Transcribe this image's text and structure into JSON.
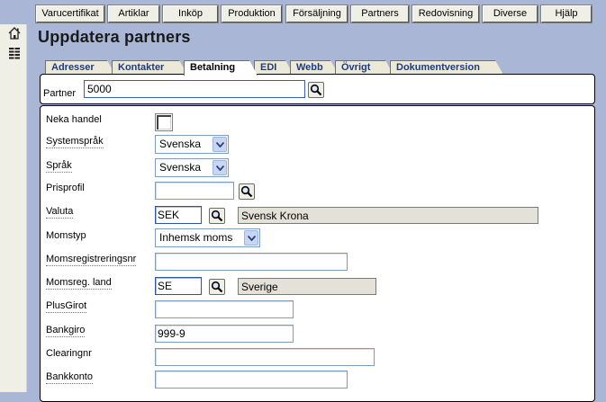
{
  "menu": {
    "items": [
      "Varucertifikat",
      "Artiklar",
      "Inköp",
      "Produktion",
      "Försäljning",
      "Partners",
      "Redovisning",
      "Diverse",
      "Hjälp"
    ]
  },
  "page": {
    "title": "Uppdatera partners"
  },
  "tabs": [
    "Adresser",
    "Kontakter",
    "Betalning",
    "EDI",
    "Webb",
    "Övrigt",
    "Dokumentversion"
  ],
  "active_tab": "Betalning",
  "partner": {
    "label": "Partner",
    "value": "5000"
  },
  "form": {
    "neka_handel": {
      "label": "Neka handel",
      "checked": false
    },
    "systemsprak": {
      "label": "Systemspråk",
      "value": "Svenska"
    },
    "sprak": {
      "label": "Språk",
      "value": "Svenska"
    },
    "prisprofil": {
      "label": "Prisprofil",
      "value": ""
    },
    "valuta": {
      "label": "Valuta",
      "code": "SEK",
      "name": "Svensk Krona"
    },
    "momstyp": {
      "label": "Momstyp",
      "value": "Inhemsk moms"
    },
    "momsregistreringsnr": {
      "label": "Momsregistreringsnr",
      "value": ""
    },
    "momsreg_land": {
      "label": "Momsreg. land",
      "code": "SE",
      "name": "Sverige"
    },
    "plusgirot": {
      "label": "PlusGirot",
      "value": ""
    },
    "bankgiro": {
      "label": "Bankgiro",
      "value": "999-9"
    },
    "clearingnr": {
      "label": "Clearingnr",
      "value": ""
    },
    "bankkonto": {
      "label": "Bankkonto",
      "value": ""
    }
  },
  "icons": {
    "home": "home-icon",
    "list": "list-icon",
    "search": "search-icon",
    "dropdown": "chevron-down-icon"
  },
  "colors": {
    "background": "#a9b6d6",
    "tab_text": "#1f3b7a",
    "dropdown_button": "#c8d6f4"
  }
}
